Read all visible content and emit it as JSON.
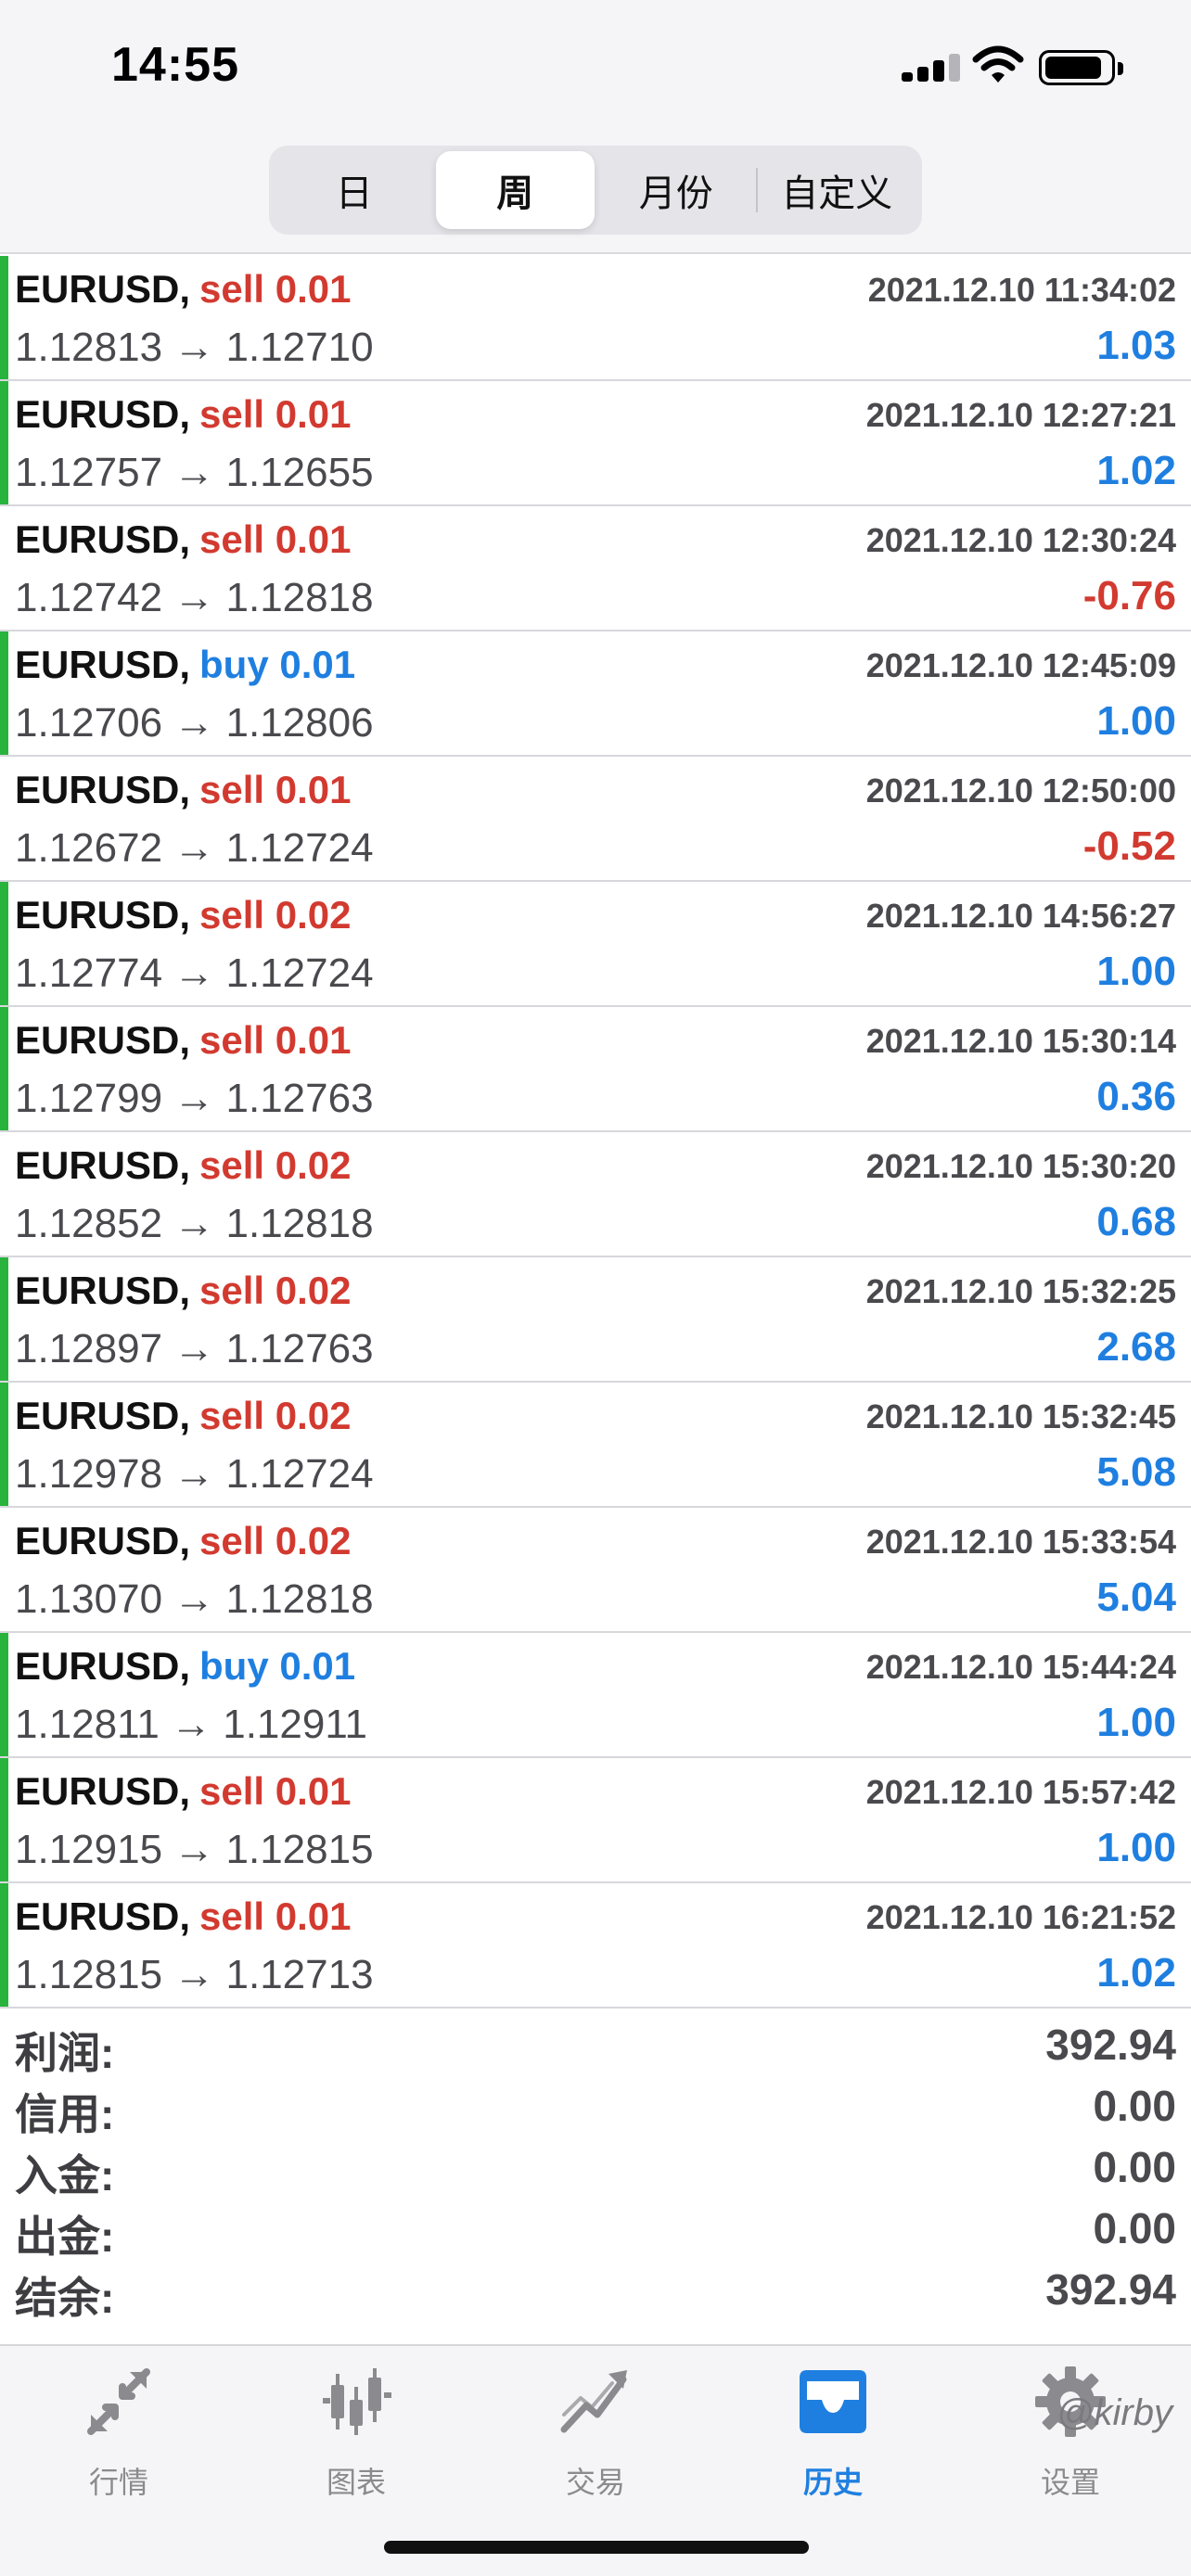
{
  "status_bar": {
    "time": "14:55"
  },
  "period_tabs": [
    {
      "label": "日",
      "active": false
    },
    {
      "label": "周",
      "active": true
    },
    {
      "label": "月份",
      "active": false
    },
    {
      "label": "自定义",
      "active": false
    }
  ],
  "deals": [
    {
      "symbol": "EURUSD,",
      "side": "sell",
      "volume": "sell 0.01",
      "time": "2021.12.10 11:34:02",
      "prices": "1.12813 → 1.12710",
      "profit": "1.03",
      "accent": true
    },
    {
      "symbol": "EURUSD,",
      "side": "sell",
      "volume": "sell 0.01",
      "time": "2021.12.10 12:27:21",
      "prices": "1.12757 → 1.12655",
      "profit": "1.02",
      "accent": true
    },
    {
      "symbol": "EURUSD,",
      "side": "sell",
      "volume": "sell 0.01",
      "time": "2021.12.10 12:30:24",
      "prices": "1.12742 → 1.12818",
      "profit": "-0.76",
      "accent": false
    },
    {
      "symbol": "EURUSD,",
      "side": "buy",
      "volume": "buy 0.01",
      "time": "2021.12.10 12:45:09",
      "prices": "1.12706 → 1.12806",
      "profit": "1.00",
      "accent": true
    },
    {
      "symbol": "EURUSD,",
      "side": "sell",
      "volume": "sell 0.01",
      "time": "2021.12.10 12:50:00",
      "prices": "1.12672 → 1.12724",
      "profit": "-0.52",
      "accent": false
    },
    {
      "symbol": "EURUSD,",
      "side": "sell",
      "volume": "sell 0.02",
      "time": "2021.12.10 14:56:27",
      "prices": "1.12774 → 1.12724",
      "profit": "1.00",
      "accent": true
    },
    {
      "symbol": "EURUSD,",
      "side": "sell",
      "volume": "sell 0.01",
      "time": "2021.12.10 15:30:14",
      "prices": "1.12799 → 1.12763",
      "profit": "0.36",
      "accent": true
    },
    {
      "symbol": "EURUSD,",
      "side": "sell",
      "volume": "sell 0.02",
      "time": "2021.12.10 15:30:20",
      "prices": "1.12852 → 1.12818",
      "profit": "0.68",
      "accent": false
    },
    {
      "symbol": "EURUSD,",
      "side": "sell",
      "volume": "sell 0.02",
      "time": "2021.12.10 15:32:25",
      "prices": "1.12897 → 1.12763",
      "profit": "2.68",
      "accent": true
    },
    {
      "symbol": "EURUSD,",
      "side": "sell",
      "volume": "sell 0.02",
      "time": "2021.12.10 15:32:45",
      "prices": "1.12978 → 1.12724",
      "profit": "5.08",
      "accent": true
    },
    {
      "symbol": "EURUSD,",
      "side": "sell",
      "volume": "sell 0.02",
      "time": "2021.12.10 15:33:54",
      "prices": "1.13070 → 1.12818",
      "profit": "5.04",
      "accent": false
    },
    {
      "symbol": "EURUSD,",
      "side": "buy",
      "volume": "buy 0.01",
      "time": "2021.12.10 15:44:24",
      "prices": "1.12811 → 1.12911",
      "profit": "1.00",
      "accent": true
    },
    {
      "symbol": "EURUSD,",
      "side": "sell",
      "volume": "sell 0.01",
      "time": "2021.12.10 15:57:42",
      "prices": "1.12915 → 1.12815",
      "profit": "1.00",
      "accent": true
    },
    {
      "symbol": "EURUSD,",
      "side": "sell",
      "volume": "sell 0.01",
      "time": "2021.12.10 16:21:52",
      "prices": "1.12815 → 1.12713",
      "profit": "1.02",
      "accent": true
    }
  ],
  "summary": [
    {
      "label": "利润:",
      "value": "392.94"
    },
    {
      "label": "信用:",
      "value": "0.00"
    },
    {
      "label": "入金:",
      "value": "0.00"
    },
    {
      "label": "出金:",
      "value": "0.00"
    },
    {
      "label": "结余:",
      "value": "392.94"
    }
  ],
  "tab_bar": [
    {
      "label": "行情",
      "icon": "arrows-quotes-icon",
      "active": false
    },
    {
      "label": "图表",
      "icon": "candlestick-chart-icon",
      "active": false
    },
    {
      "label": "交易",
      "icon": "trade-trend-icon",
      "active": false
    },
    {
      "label": "历史",
      "icon": "history-tray-icon",
      "active": true
    },
    {
      "label": "设置",
      "icon": "gear-icon",
      "active": false
    }
  ],
  "watermark": "@kirby",
  "colors": {
    "sell": "#d23a30",
    "buy": "#1f7fe0",
    "profit_positive": "#1f7fe0",
    "profit_negative": "#d23a30",
    "accent_bar": "#28b43c",
    "tab_active": "#1f7fe0",
    "tab_inactive": "#8a8a8f"
  }
}
